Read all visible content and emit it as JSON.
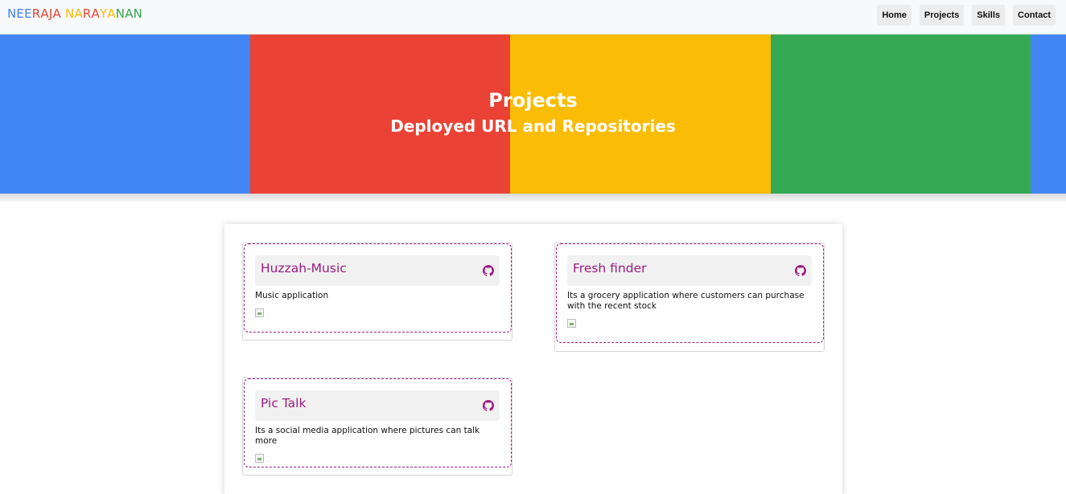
{
  "brand": {
    "letters": [
      {
        "ch": "N",
        "color": "#4285f4"
      },
      {
        "ch": "E",
        "color": "#4285f4"
      },
      {
        "ch": "E",
        "color": "#4285f4"
      },
      {
        "ch": "R",
        "color": "#ea4335"
      },
      {
        "ch": "A",
        "color": "#ea4335"
      },
      {
        "ch": "J",
        "color": "#ea4335"
      },
      {
        "ch": "A",
        "color": "#ea4335"
      },
      {
        "ch": " ",
        "color": "#000000"
      },
      {
        "ch": "N",
        "color": "#fbbc05"
      },
      {
        "ch": "A",
        "color": "#fbbc05"
      },
      {
        "ch": "R",
        "color": "#ea4335"
      },
      {
        "ch": "A",
        "color": "#ea4335"
      },
      {
        "ch": "Y",
        "color": "#fbbc05"
      },
      {
        "ch": "A",
        "color": "#fbbc05"
      },
      {
        "ch": "N",
        "color": "#34a853"
      },
      {
        "ch": "A",
        "color": "#34a853"
      },
      {
        "ch": "N",
        "color": "#34a853"
      }
    ]
  },
  "nav": {
    "items": [
      {
        "label": "Home"
      },
      {
        "label": "Projects"
      },
      {
        "label": "Skills"
      },
      {
        "label": "Contact"
      }
    ]
  },
  "hero": {
    "title": "Projects",
    "subtitle": "Deployed URL and Repositories",
    "stripe_colors": [
      "#4285f4",
      "#ea4335",
      "#fbbc05",
      "#34a853",
      "#4285f4"
    ]
  },
  "projects": [
    {
      "title": "Huzzah-Music",
      "description": "Music application",
      "icon": "github-icon"
    },
    {
      "title": "Fresh finder",
      "description": "Its a grocery application where customers can purchase with the recent stock",
      "icon": "github-icon"
    },
    {
      "title": "Pic Talk",
      "description": "Its a social media application where pictures can talk more",
      "icon": "github-icon"
    }
  ],
  "accent_color": "#9c1b82"
}
